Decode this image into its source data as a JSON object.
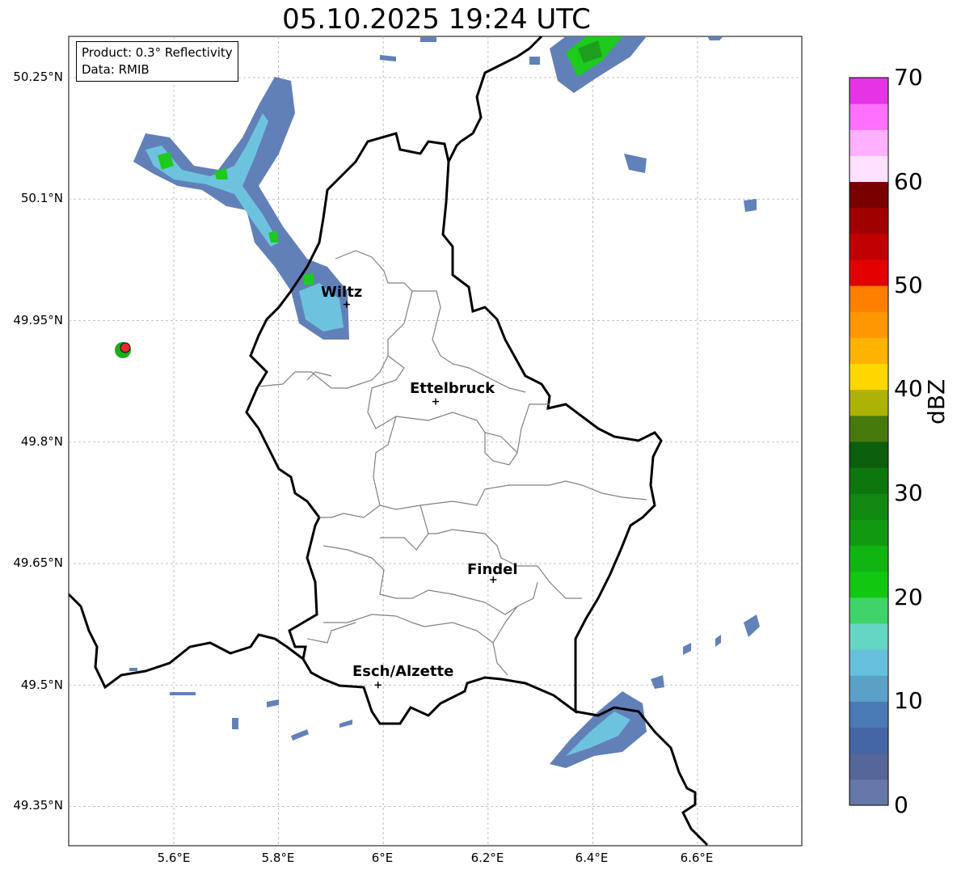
{
  "title": "05.10.2025 19:24 UTC",
  "info": {
    "product": "Product: 0.3° Reflectivity",
    "data_source": "Data: RMIB"
  },
  "axes": {
    "lat_ticks": [
      "50.25°N",
      "50.1°N",
      "49.95°N",
      "49.8°N",
      "49.65°N",
      "49.5°N",
      "49.35°N"
    ],
    "lon_ticks": [
      "5.6°E",
      "5.8°E",
      "6°E",
      "6.2°E",
      "6.4°E",
      "6.6°E"
    ],
    "grid": true
  },
  "cities": [
    {
      "name": "Wiltz",
      "lon": 5.93,
      "lat": 49.97
    },
    {
      "name": "Ettelbruck",
      "lon": 6.1,
      "lat": 49.85
    },
    {
      "name": "Findel",
      "lon": 6.21,
      "lat": 49.63
    },
    {
      "name": "Esch/Alzette",
      "lon": 5.99,
      "lat": 49.5
    }
  ],
  "radar_site_marker": {
    "lon": 5.51,
    "lat": 49.91
  },
  "colorbar": {
    "label": "dBZ",
    "ticks": [
      "70",
      "60",
      "50",
      "40",
      "30",
      "20",
      "10",
      "0"
    ],
    "range": [
      0,
      70
    ],
    "colors": [
      "#6677aa",
      "#556699",
      "#4466a5",
      "#4a7ab5",
      "#5aa0c8",
      "#66c0dd",
      "#66d6c4",
      "#3fd46a",
      "#11c811",
      "#11b511",
      "#119a11",
      "#118811",
      "#0d770d",
      "#0b5e0b",
      "#467a0c",
      "#aeb204",
      "#ffd700",
      "#fdb300",
      "#ff9800",
      "#ff7f00",
      "#e20000",
      "#c10000",
      "#a10000",
      "#7a0000",
      "#ffe0ff",
      "#ffb0ff",
      "#ff70ff",
      "#e633e6"
    ]
  }
}
